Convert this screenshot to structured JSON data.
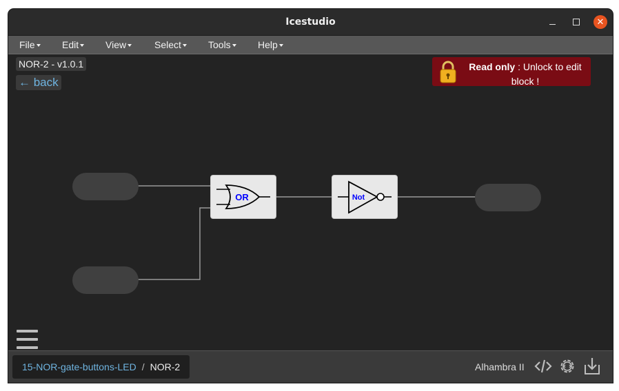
{
  "window": {
    "title": "Icestudio"
  },
  "menu": [
    {
      "label": "File"
    },
    {
      "label": "Edit"
    },
    {
      "label": "View"
    },
    {
      "label": "Select"
    },
    {
      "label": "Tools"
    },
    {
      "label": "Help"
    }
  ],
  "canvas": {
    "version_label": "NOR-2 - v1.0.1",
    "back_label": "← back",
    "readonly": {
      "bold": "Read only",
      "rest": " : Unlock to edit block !"
    },
    "or_gate_label": "OR",
    "not_gate_label": "Not"
  },
  "footer": {
    "breadcrumb": {
      "parent": "15-NOR-gate-buttons-LED",
      "separator": "/",
      "current": "NOR-2"
    },
    "board": "Alhambra II"
  },
  "colors": {
    "accent_link": "#6fb4e0",
    "readonly_bg": "#7a0c14",
    "close_button": "#e95420",
    "gate_text": "#0000ff"
  },
  "icons": [
    "lock-icon",
    "hamburger-menu-icon",
    "code-icon",
    "gear-icon",
    "download-icon"
  ]
}
